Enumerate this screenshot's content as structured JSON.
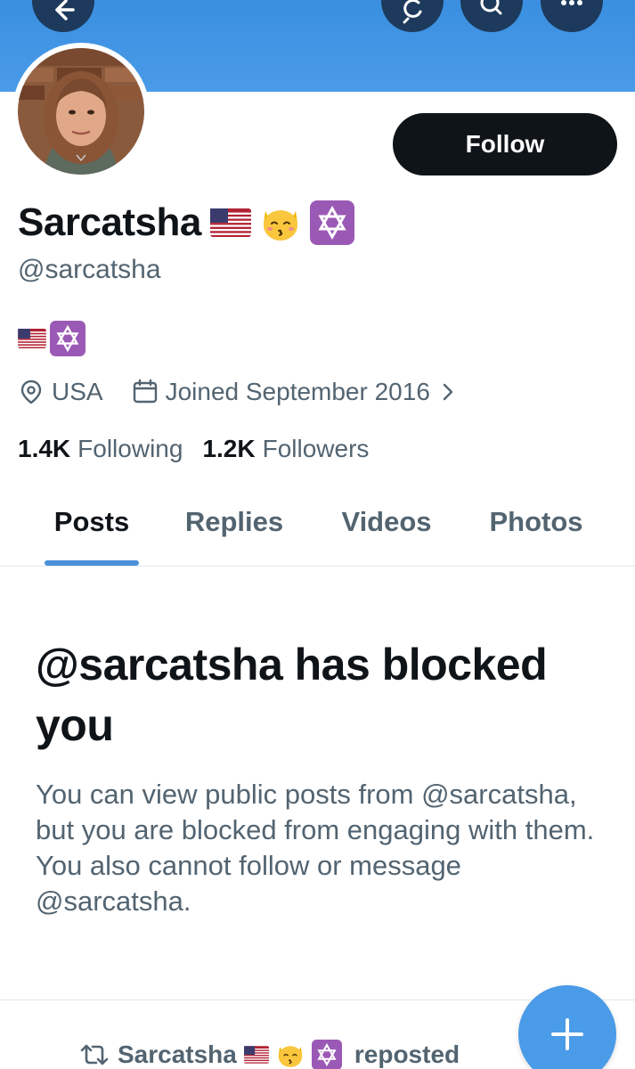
{
  "header": {
    "back_icon": "arrow-left-icon",
    "actions": [
      "refresh-search-icon",
      "search-icon",
      "more-icon"
    ],
    "banner_color": "#4a9be8"
  },
  "profile": {
    "display_name": "Sarcatsha",
    "name_emojis": [
      "us-flag-emoji",
      "kissing-cat-emoji",
      "star-of-david-emoji"
    ],
    "handle": "@sarcatsha",
    "bio_emojis": [
      "us-flag-emoji",
      "star-of-david-emoji"
    ],
    "location": "USA",
    "joined": "Joined September 2016",
    "following_count": "1.4K",
    "following_label": "Following",
    "followers_count": "1.2K",
    "followers_label": "Followers",
    "follow_label": "Follow"
  },
  "tabs": [
    {
      "label": "Posts",
      "active": true
    },
    {
      "label": "Replies",
      "active": false
    },
    {
      "label": "Videos",
      "active": false
    },
    {
      "label": "Photos",
      "active": false
    }
  ],
  "blocked": {
    "title": "@sarcatsha has blocked you",
    "description": "You can view public posts from @sarcatsha, but you are blocked from engaging with them. You also cannot follow or message @sarcatsha."
  },
  "repost": {
    "name": "Sarcatsha",
    "label": "reposted"
  },
  "fab": {
    "icon": "plus-icon"
  },
  "colors": {
    "accent": "#4a90d9",
    "text": "#0f1419",
    "secondary": "#536471"
  }
}
